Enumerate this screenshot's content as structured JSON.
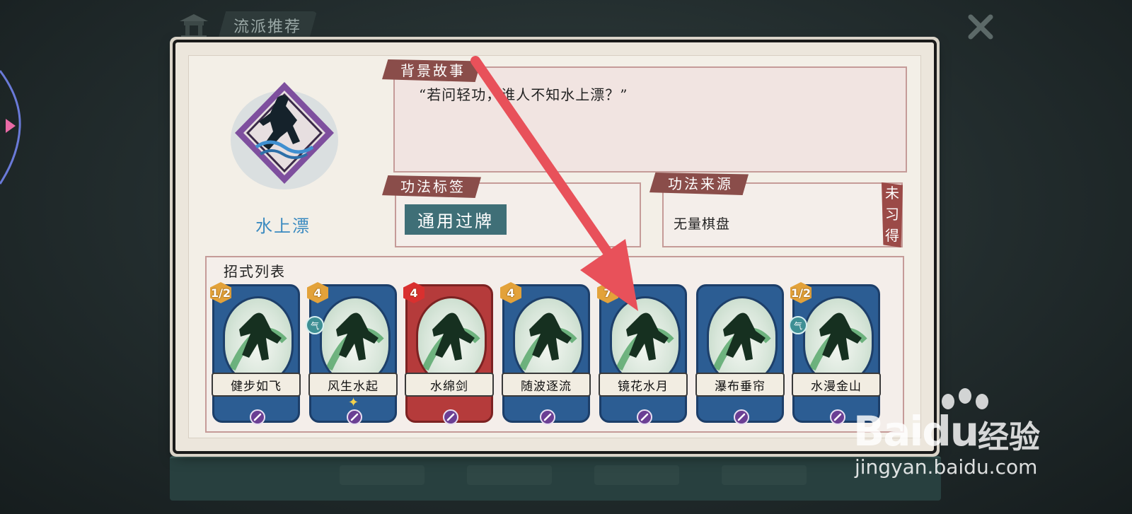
{
  "header": {
    "school_tab": "流派推荐"
  },
  "skill": {
    "name": "水上漂",
    "background_title": "背景故事",
    "background_quote": "“若问轻功，谁人不知水上漂？”",
    "tags_title": "功法标签",
    "tag": "通用过牌",
    "source_title": "功法来源",
    "source": "无量棋盘",
    "status": "未习得"
  },
  "moves": {
    "title": "招式列表",
    "cards": [
      {
        "name": "健步如飞",
        "cost": "1/2",
        "color": "blue",
        "qi": false,
        "upgrade": false
      },
      {
        "name": "风生水起",
        "cost": "4",
        "color": "blue",
        "qi": true,
        "upgrade": true
      },
      {
        "name": "水绵剑",
        "cost": "4",
        "color": "red",
        "qi": false,
        "upgrade": false
      },
      {
        "name": "随波逐流",
        "cost": "4",
        "color": "blue",
        "qi": false,
        "upgrade": false
      },
      {
        "name": "镜花水月",
        "cost": "7",
        "color": "blue",
        "qi": false,
        "upgrade": false
      },
      {
        "name": "瀑布垂帘",
        "cost": "",
        "color": "blue",
        "qi": false,
        "upgrade": false
      },
      {
        "name": "水漫金山",
        "cost": "1/2",
        "color": "blue",
        "qi": true,
        "upgrade": false
      }
    ]
  },
  "watermark": {
    "brand": "Baidu",
    "brand_cn": "经验",
    "url": "jingyan.baidu.com"
  },
  "colors": {
    "accent_red": "#8a4d4a",
    "tag_teal": "#3f6f77",
    "card_blue": "#2c5d93",
    "card_red": "#b53b3b",
    "annotation_arrow": "#e8515a"
  },
  "icons": {
    "close": "close-x-icon",
    "temple": "pavilion-icon",
    "card_type": "slash-technique-icon",
    "qi": "qi-icon"
  }
}
